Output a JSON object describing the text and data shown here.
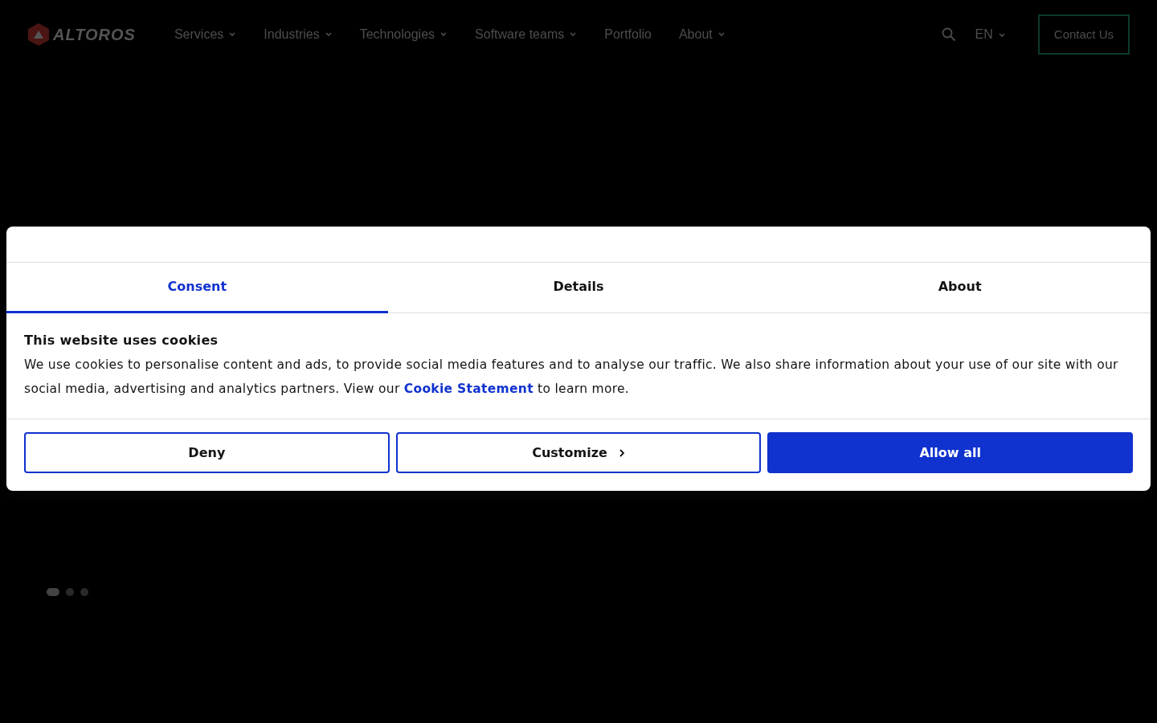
{
  "header": {
    "logo": "ALTOROS",
    "nav": [
      {
        "label": "Services",
        "dropdown": true
      },
      {
        "label": "Industries",
        "dropdown": true
      },
      {
        "label": "Technologies",
        "dropdown": true
      },
      {
        "label": "Software teams",
        "dropdown": true
      },
      {
        "label": "Portfolio",
        "dropdown": false
      },
      {
        "label": "About",
        "dropdown": true
      }
    ],
    "language": "EN",
    "contact_button": "Contact Us"
  },
  "hero": {
    "slides": [
      {
        "selected": true
      },
      {
        "selected": false
      },
      {
        "selected": false
      }
    ]
  },
  "cookie_dialog": {
    "tabs": [
      {
        "label": "Consent",
        "selected": true
      },
      {
        "label": "Details",
        "selected": false
      },
      {
        "label": "About",
        "selected": false
      }
    ],
    "title": "This website uses cookies",
    "text_before": "We use cookies to personalise content and ads, to provide social media features and to analyse our traffic. We also share information about your use of our site with our social media, advertising and analytics partners. View our",
    "link": "Cookie Statement",
    "text_after": "to learn more.",
    "buttons": [
      {
        "label": "Deny",
        "kind": "outline"
      },
      {
        "label": "Customize",
        "kind": "chevron"
      },
      {
        "label": "Allow all",
        "kind": "primary"
      }
    ]
  }
}
